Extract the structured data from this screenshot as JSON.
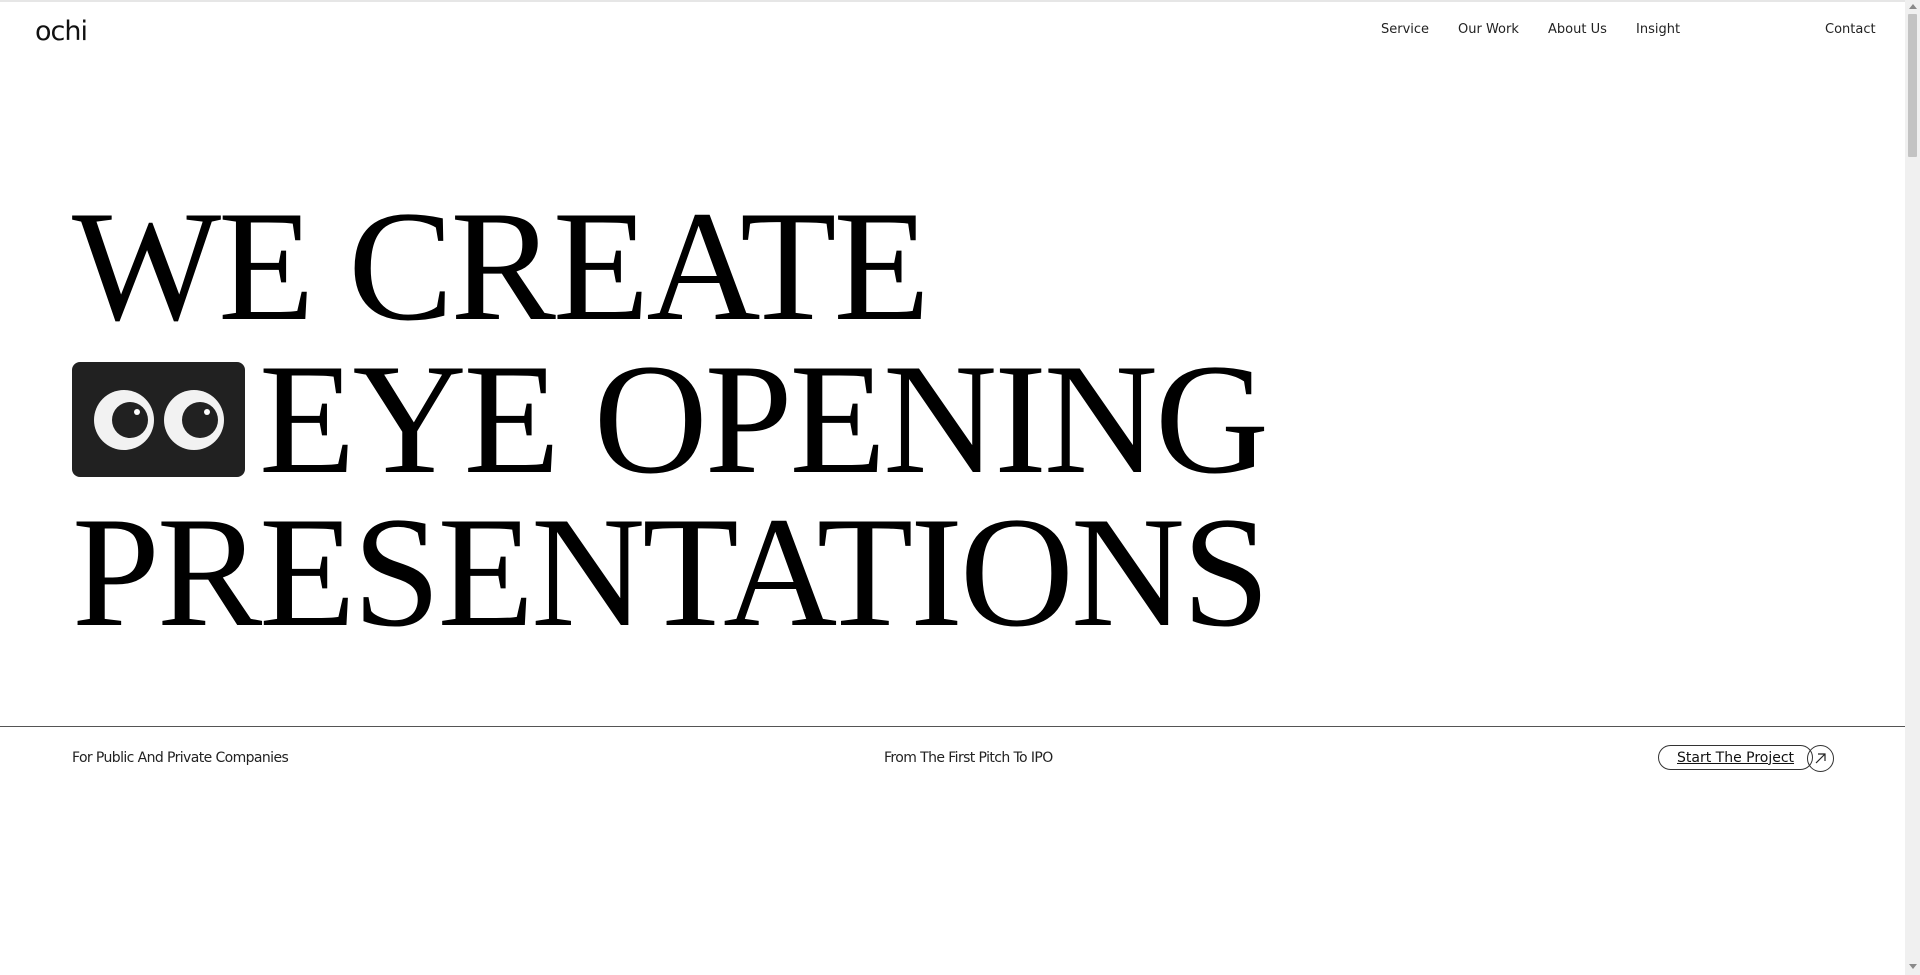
{
  "brand": {
    "logo_text": "ochi"
  },
  "nav": {
    "items": [
      {
        "label": "Service"
      },
      {
        "label": "Our Work"
      },
      {
        "label": "About Us"
      },
      {
        "label": "Insight"
      }
    ],
    "contact": "Contact"
  },
  "hero": {
    "line1": "WE CREATE",
    "line2": "EYE OPENING",
    "line3": "PRESENTATIONS"
  },
  "footer": {
    "left": "For Public And Private Companies",
    "middle": "From The First Pitch To IPO",
    "cta_label": "Start The Project"
  },
  "icons": {
    "eyes": "eyes-icon",
    "cta_arrow": "arrow-up-right-icon"
  },
  "colors": {
    "background": "#ffffff",
    "text": "#000000",
    "eyes_box": "#212121"
  }
}
